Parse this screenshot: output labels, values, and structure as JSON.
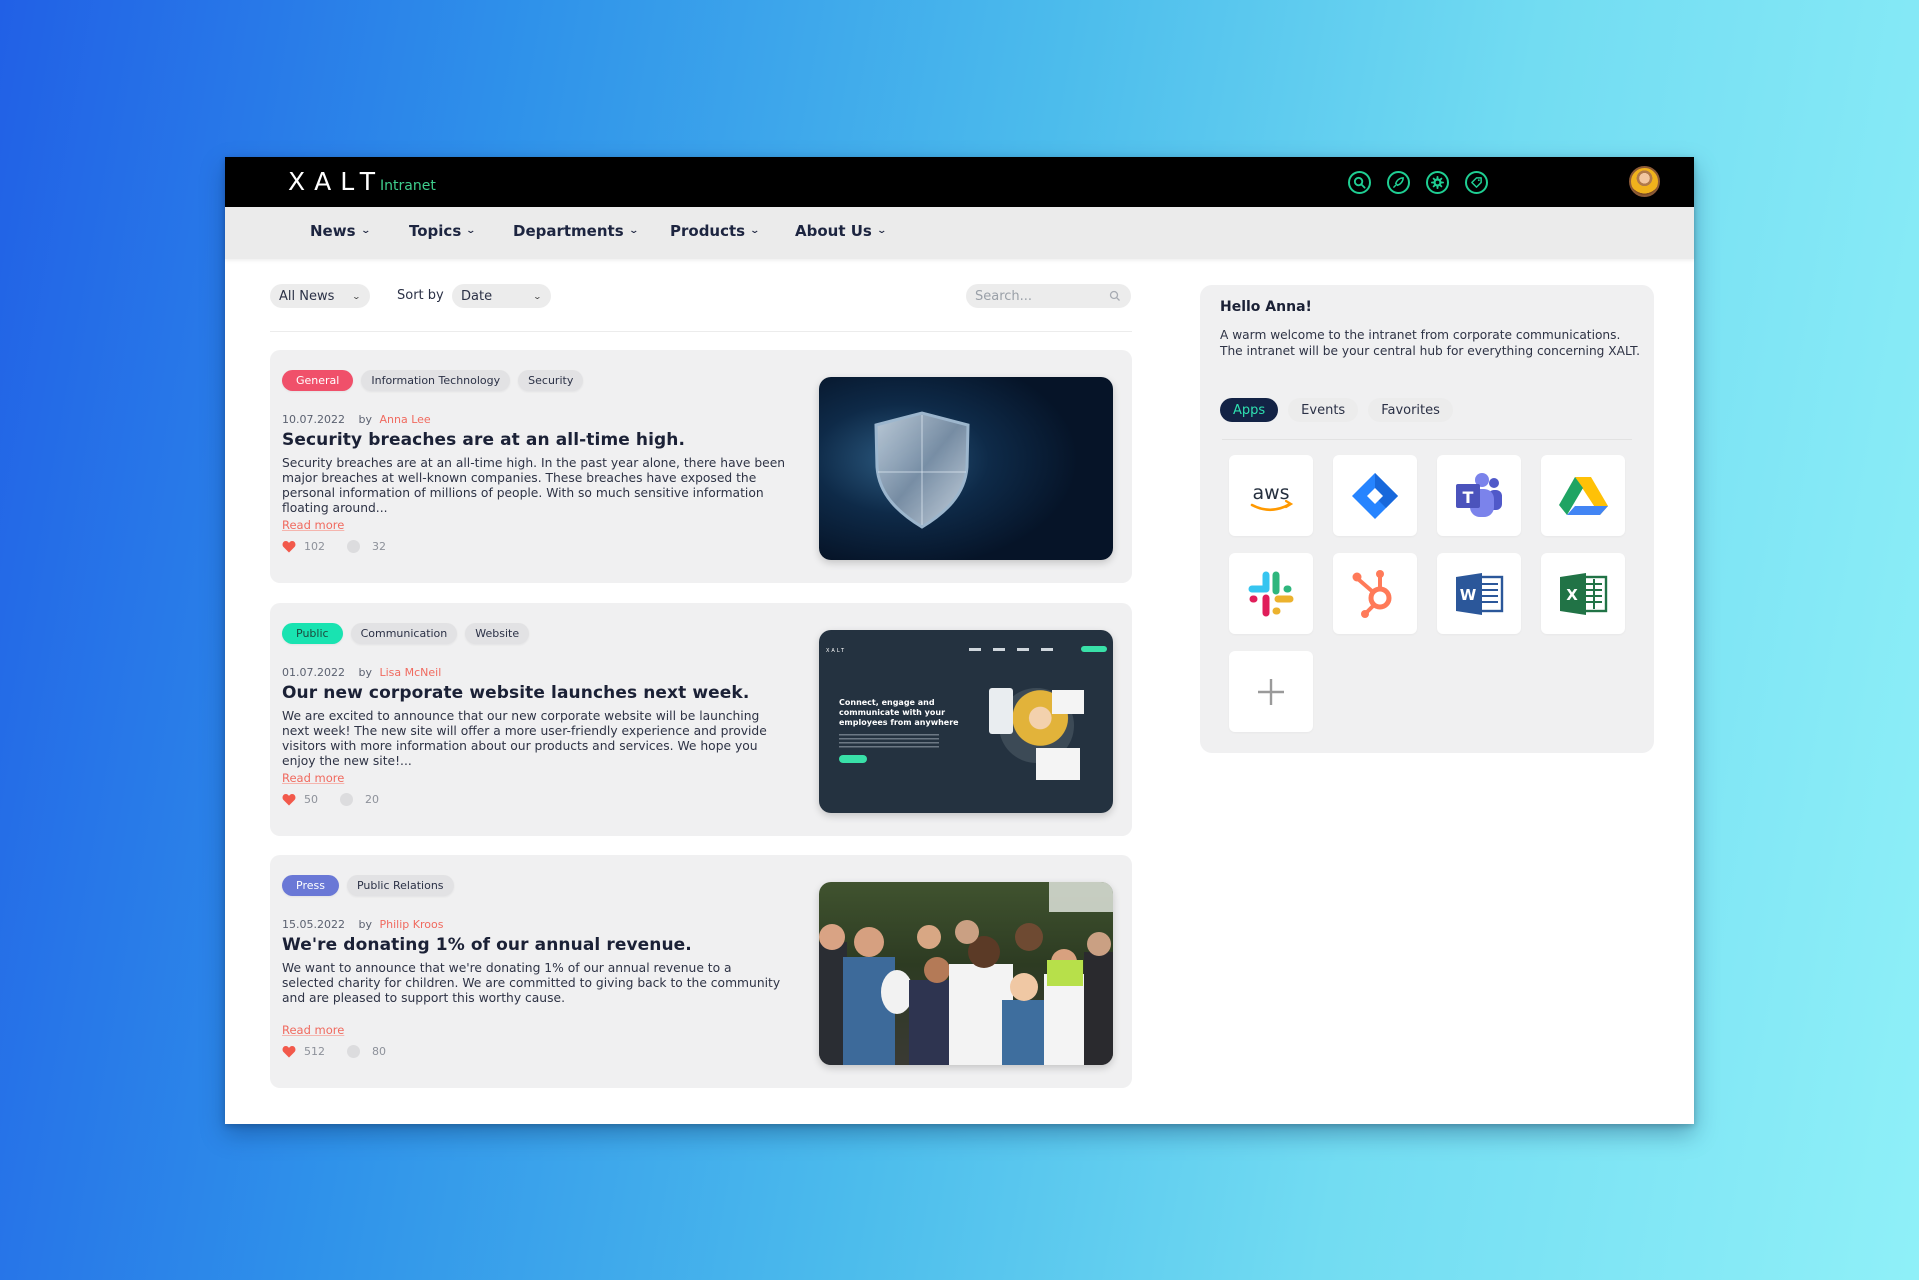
{
  "header": {
    "logo_main": "XALT",
    "logo_sub": "Intranet",
    "icons": [
      "search-icon",
      "rocket-icon",
      "gear-icon",
      "tag-icon"
    ],
    "accent_color": "#1fcf93"
  },
  "nav": {
    "items": [
      {
        "label": "News"
      },
      {
        "label": "Topics"
      },
      {
        "label": "Departments"
      },
      {
        "label": "Products"
      },
      {
        "label": "About Us"
      }
    ]
  },
  "filters": {
    "category_value": "All News",
    "sort_label": "Sort by",
    "sort_value": "Date",
    "search_placeholder": "Search..."
  },
  "articles": [
    {
      "tags": [
        {
          "label": "General",
          "color": "#f0506a"
        },
        {
          "label": "Information Technology"
        },
        {
          "label": "Security"
        }
      ],
      "date": "10.07.2022",
      "by": "by",
      "author": "Anna Lee",
      "title": "Security breaches are at an all-time high.",
      "excerpt": "Security breaches are at an all-time high. In the past year alone, there have been major breaches at well-known companies. These breaches have exposed the personal information of millions of people. With so much sensitive information floating around...",
      "read_more": "Read more",
      "likes": "102",
      "comments": "32",
      "image": "shield-image"
    },
    {
      "tags": [
        {
          "label": "Public",
          "color": "#19e3b1"
        },
        {
          "label": "Communication"
        },
        {
          "label": "Website"
        }
      ],
      "date": "01.07.2022",
      "by": "by",
      "author": "Lisa McNeil",
      "title": "Our new corporate website launches next week.",
      "excerpt": "We are excited to announce that our new corporate website will be launching next week! The new site will offer a more user-friendly experience and provide visitors with more information about our products and services. We hope you enjoy the new site!...",
      "read_more": "Read more",
      "likes": "50",
      "comments": "20",
      "image": "website-screenshot-image",
      "image_headline": "Connect, engage and communicate with your employees from anywhere"
    },
    {
      "tags": [
        {
          "label": "Press",
          "color": "#6a78d6"
        },
        {
          "label": "Public Relations"
        }
      ],
      "date": "15.05.2022",
      "by": "by",
      "author": "Philip Kroos",
      "title": "We're donating 1% of our annual revenue.",
      "excerpt": "We want to announce that we're donating 1% of our annual revenue to a selected charity for children. We are committed to giving back to the community and are pleased to support this worthy cause.",
      "read_more": "Read more",
      "likes": "512",
      "comments": "80",
      "image": "group-photo-image"
    }
  ],
  "sidebar": {
    "greeting": "Hello Anna!",
    "welcome_text": "A warm welcome to the intranet from corporate communications. The intranet will be your central hub for everything concerning XALT.",
    "tabs": [
      {
        "label": "Apps",
        "active": true
      },
      {
        "label": "Events",
        "active": false
      },
      {
        "label": "Favorites",
        "active": false
      }
    ],
    "apps": [
      {
        "name": "aws",
        "label": "aws"
      },
      {
        "name": "jira"
      },
      {
        "name": "teams",
        "label": "T"
      },
      {
        "name": "google-drive"
      },
      {
        "name": "slack"
      },
      {
        "name": "hubspot"
      },
      {
        "name": "word",
        "label": "W"
      },
      {
        "name": "excel",
        "label": "X"
      },
      {
        "name": "add"
      }
    ]
  }
}
